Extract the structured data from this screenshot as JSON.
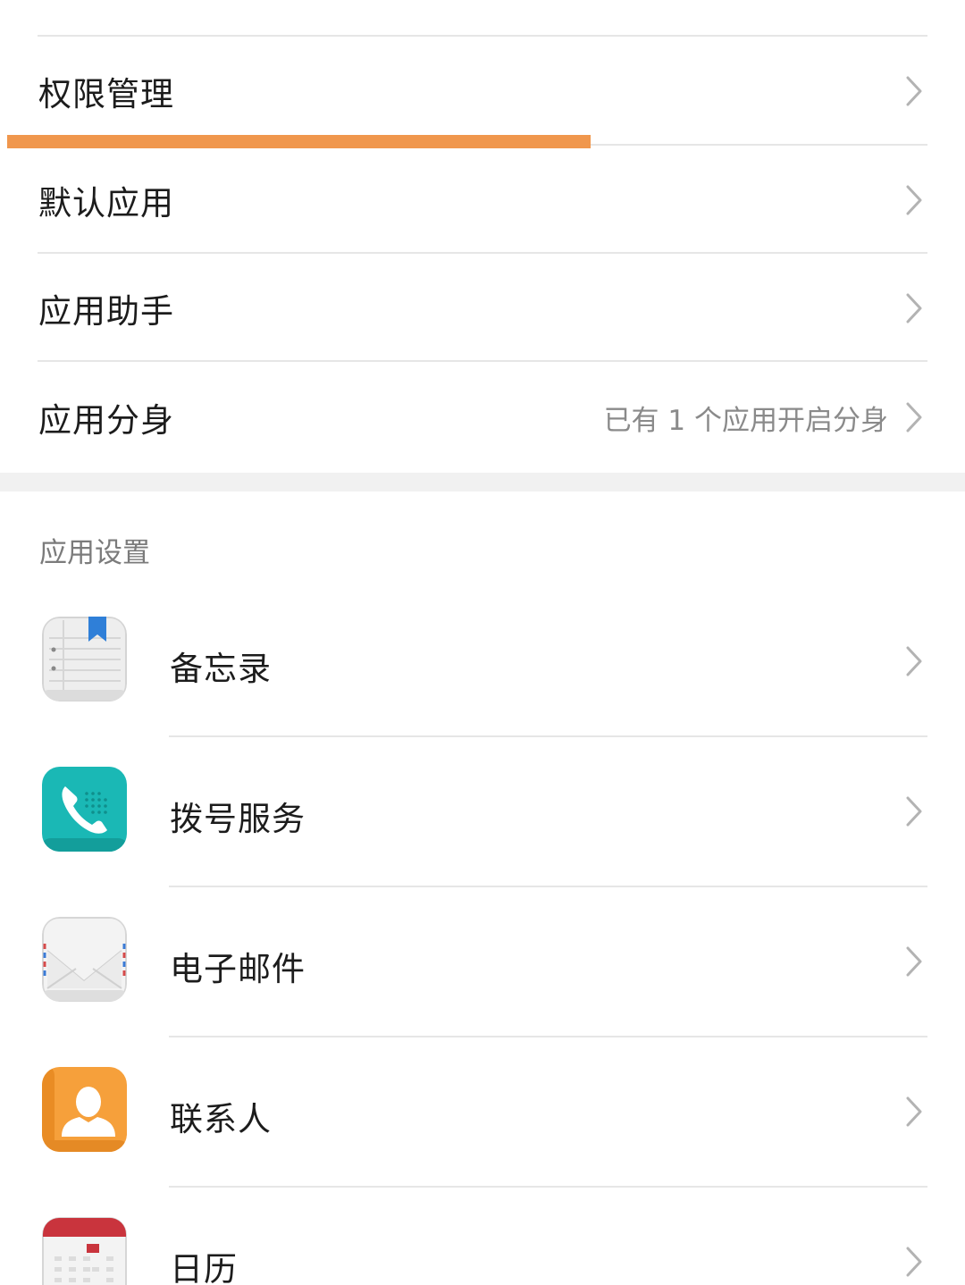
{
  "menu": {
    "items": [
      {
        "label": "权限管理",
        "value": ""
      },
      {
        "label": "默认应用",
        "value": ""
      },
      {
        "label": "应用助手",
        "value": ""
      },
      {
        "label": "应用分身",
        "value": "已有 1 个应用开启分身"
      }
    ]
  },
  "loading_progress": 0.6,
  "section": {
    "title": "应用设置"
  },
  "apps": [
    {
      "label": "备忘录",
      "icon": "notepad-icon"
    },
    {
      "label": "拨号服务",
      "icon": "phone-icon"
    },
    {
      "label": "电子邮件",
      "icon": "email-icon"
    },
    {
      "label": "联系人",
      "icon": "contacts-icon"
    },
    {
      "label": "日历",
      "icon": "calendar-icon"
    }
  ],
  "colors": {
    "progress": "#f0974d",
    "phone_icon": "#1ab8b5",
    "contacts_icon": "#f6a03b",
    "calendar_header": "#c9343d",
    "note_bookmark": "#2f7fd8"
  }
}
